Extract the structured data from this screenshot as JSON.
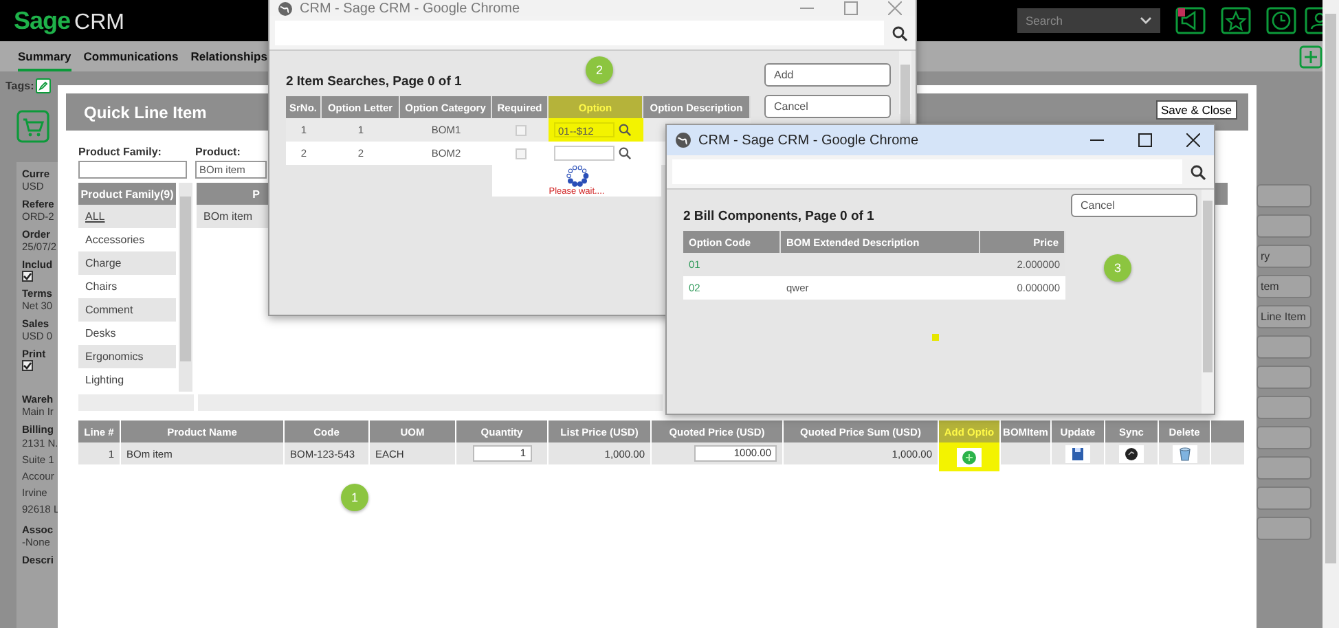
{
  "topbar": {
    "brand": "Sage",
    "product": "CRM",
    "search_placeholder": "Search"
  },
  "tabs": [
    {
      "label": "Summary",
      "selected": true
    },
    {
      "label": "Communications",
      "selected": false
    },
    {
      "label": "Relationships",
      "selected": false
    }
  ],
  "tags_label": "Tags:",
  "summary_fields": [
    {
      "label": "Curre",
      "kind": "text",
      "value": "USD"
    },
    {
      "label": "Refere",
      "kind": "text",
      "value": "ORD-2"
    },
    {
      "label": "Order",
      "kind": "text",
      "value": "25/07/2"
    },
    {
      "label": "Includ",
      "kind": "checkbox",
      "checked": true
    },
    {
      "label": "Terms",
      "kind": "text",
      "value": "Net 30"
    },
    {
      "label": "Sales",
      "kind": "text",
      "value": "USD 0"
    },
    {
      "label": "Print",
      "kind": "checkbox",
      "checked": true
    },
    {
      "label": "Wareh",
      "kind": "text",
      "value": "Main Ir"
    },
    {
      "label": "Billing",
      "kind": "lines",
      "lines": [
        "2131 N.",
        "Suite 1",
        "Accour",
        "Irvine",
        "92618 L"
      ]
    },
    {
      "label": "Assoc",
      "kind": "text",
      "value": "-None"
    },
    {
      "label": "Descri",
      "kind": "text"
    }
  ],
  "side_buttons": [
    {
      "kind": "blank"
    },
    {
      "kind": "blank"
    },
    {
      "kind": "labeled",
      "label": "ry"
    },
    {
      "kind": "labeled",
      "label": "tem"
    },
    {
      "kind": "labeled",
      "label": "Line Item"
    },
    {
      "kind": "blank"
    },
    {
      "kind": "blank"
    },
    {
      "kind": "blank"
    },
    {
      "kind": "blank"
    },
    {
      "kind": "blank"
    },
    {
      "kind": "blank"
    },
    {
      "kind": "blank"
    }
  ],
  "quick_line_item": {
    "title": "Quick Line Item",
    "save_button": "Save & Close",
    "product_family_label": "Product Family:",
    "product_label": "Product:",
    "product_value": "BOm item",
    "family_header": "Product Family(9)",
    "families": [
      {
        "label": "ALL",
        "selected": true
      },
      {
        "label": "Accessories",
        "selected": false
      },
      {
        "label": "Charge",
        "selected": false
      },
      {
        "label": "Chairs",
        "selected": false
      },
      {
        "label": "Comment",
        "selected": false
      },
      {
        "label": "Desks",
        "selected": false
      },
      {
        "label": "Ergonomics",
        "selected": false
      },
      {
        "label": "Lighting",
        "selected": false
      }
    ],
    "product_header": "P",
    "products": [
      "BOm item"
    ],
    "line_columns": [
      {
        "label": "Line #",
        "highlighted": false
      },
      {
        "label": "Product Name",
        "highlighted": false
      },
      {
        "label": "Code",
        "highlighted": false
      },
      {
        "label": "UOM",
        "highlighted": false
      },
      {
        "label": "Quantity",
        "highlighted": false
      },
      {
        "label": "List Price (USD)",
        "highlighted": false
      },
      {
        "label": "Quoted Price (USD)",
        "highlighted": false
      },
      {
        "label": "Quoted Price Sum (USD)",
        "highlighted": false
      },
      {
        "label": "Add Optio",
        "highlighted": true
      },
      {
        "label": "BOMItem",
        "highlighted": false
      },
      {
        "label": "Update",
        "highlighted": false
      },
      {
        "label": "Sync",
        "highlighted": false
      },
      {
        "label": "Delete",
        "highlighted": false
      },
      {
        "highlighted": false
      }
    ],
    "line_rows": [
      {
        "cells": [
          {
            "kind": "number",
            "text": "1"
          },
          {
            "kind": "text",
            "text": "BOm item"
          },
          {
            "kind": "text",
            "text": "BOM-123-543"
          },
          {
            "kind": "text",
            "text": "EACH"
          },
          {
            "kind": "input",
            "text": "1"
          },
          {
            "kind": "number",
            "text": "1,000.00"
          },
          {
            "kind": "input",
            "text": "1000.00"
          },
          {
            "kind": "number",
            "text": "1,000.00"
          },
          {
            "kind": "add-option"
          },
          {
            "kind": "empty"
          },
          {
            "kind": "save"
          },
          {
            "kind": "sync"
          },
          {
            "kind": "delete"
          },
          {
            "kind": "empty"
          }
        ]
      }
    ],
    "step_marker": "1"
  },
  "item_search_window": {
    "title": "CRM - Sage CRM - Google Chrome",
    "heading": "2 Item Searches, Page 0 of 1",
    "columns": [
      {
        "label": "SrNo.",
        "highlighted": false
      },
      {
        "label": "Option Letter",
        "highlighted": false
      },
      {
        "label": "Option Category",
        "highlighted": false
      },
      {
        "label": "Required",
        "highlighted": false
      },
      {
        "label": "Option",
        "highlighted": true
      },
      {
        "label": "Option Description",
        "highlighted": false
      }
    ],
    "rows": [
      {
        "srno": "1",
        "option_letter": "1",
        "option_category": "BOM1",
        "required": false,
        "option": "01--$12",
        "highlighted": true
      },
      {
        "srno": "2",
        "option_letter": "2",
        "option_category": "BOM2",
        "required": false,
        "highlighted": false
      }
    ],
    "loading_text": "Please wait....",
    "buttons": [
      "Add",
      "Cancel"
    ],
    "step_marker": "2"
  },
  "bill_window": {
    "title": "CRM - Sage CRM - Google Chrome",
    "heading": "2 Bill Components, Page 0 of 1",
    "columns": [
      "Option Code",
      "BOM Extended Description",
      "Price"
    ],
    "rows": [
      {
        "option_code": "01",
        "price": "2.000000"
      },
      {
        "option_code": "02",
        "description": "qwer",
        "price": "0.000000"
      }
    ],
    "cancel_button": "Cancel",
    "step_marker": "3"
  }
}
